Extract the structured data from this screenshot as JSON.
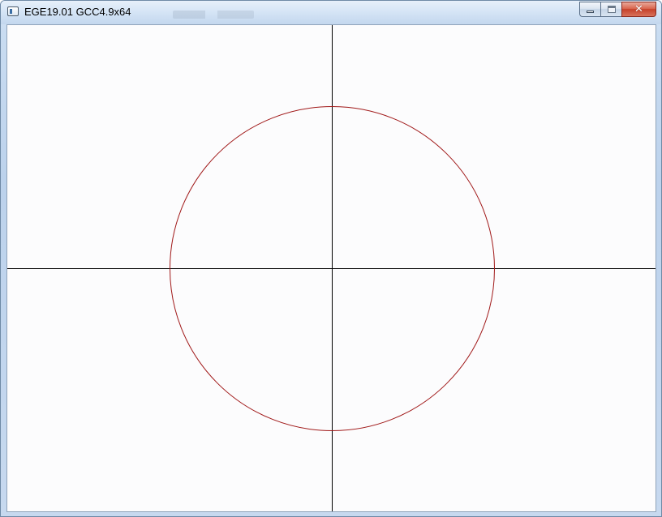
{
  "window": {
    "title": "EGE19.01 GCC4.9x64",
    "icon": "app-window-icon",
    "controls": {
      "minimize_icon": "minimize-icon",
      "maximize_icon": "maximize-icon",
      "close_icon": "close-icon",
      "close_glyph": "✕"
    }
  },
  "canvas": {
    "background": "#fcfcfd",
    "axis_color": "#000000",
    "circle_color": "#a01818"
  }
}
